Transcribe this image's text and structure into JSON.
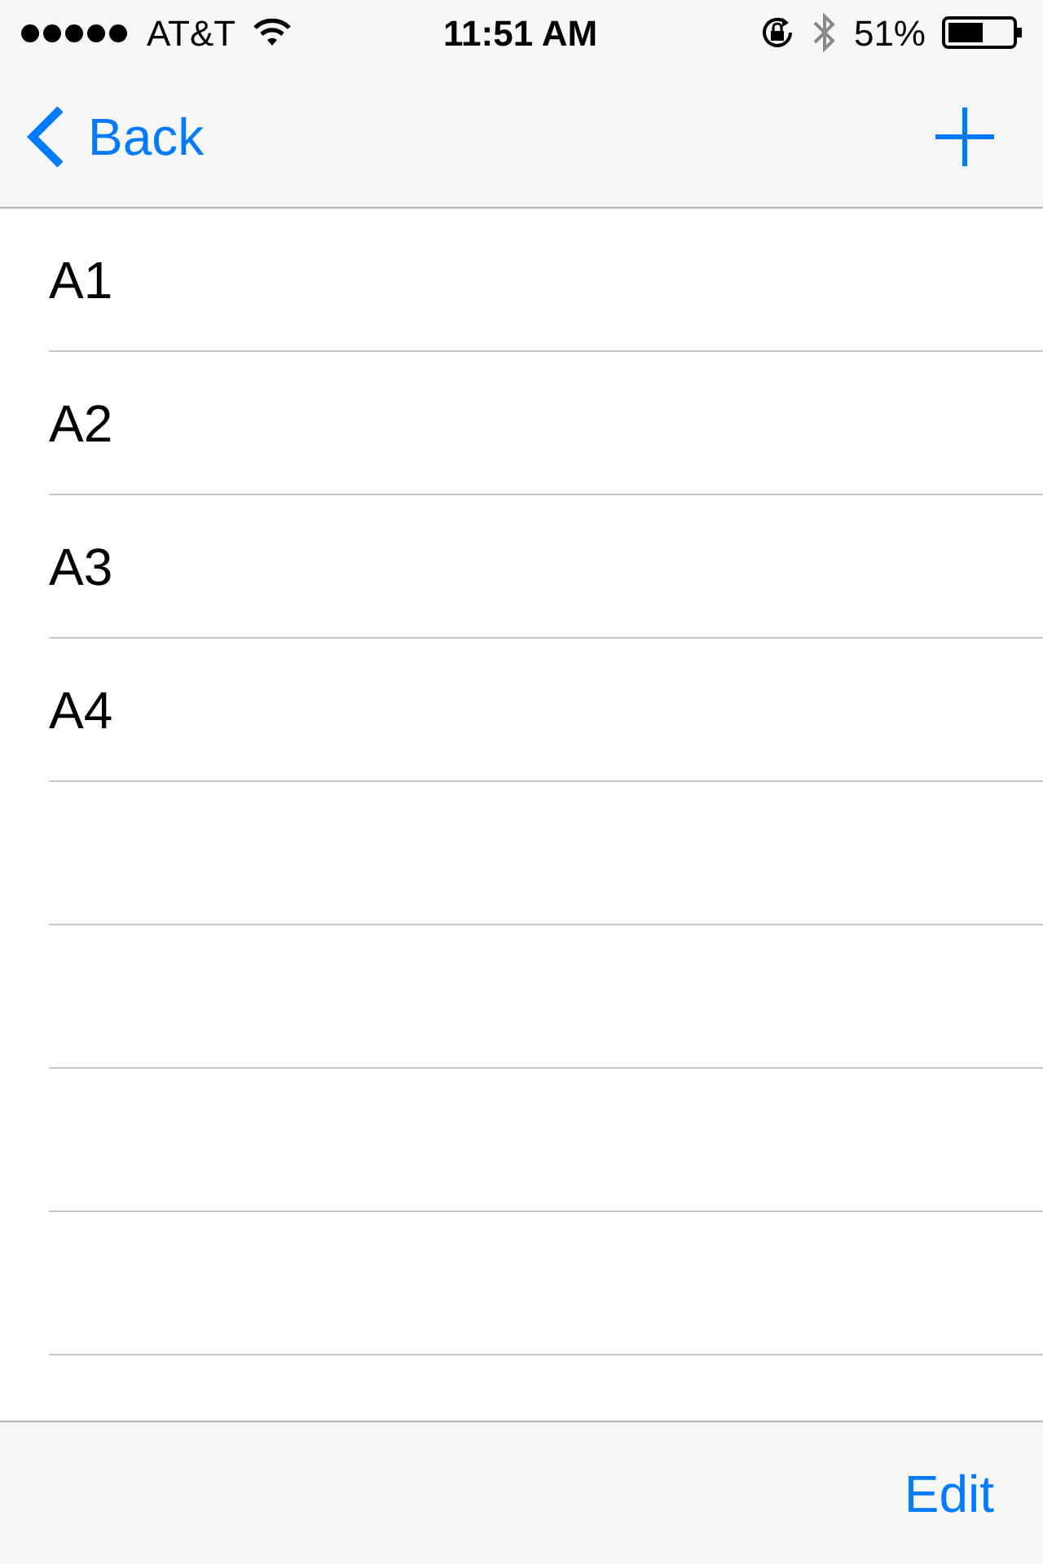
{
  "status_bar": {
    "carrier": "AT&T",
    "time": "11:51 AM",
    "battery": "51%"
  },
  "nav_bar": {
    "back": "Back"
  },
  "list": {
    "rows": [
      {
        "label": "A1"
      },
      {
        "label": "A2"
      },
      {
        "label": "A3"
      },
      {
        "label": "A4"
      }
    ]
  },
  "toolbar": {
    "edit": "Edit"
  }
}
